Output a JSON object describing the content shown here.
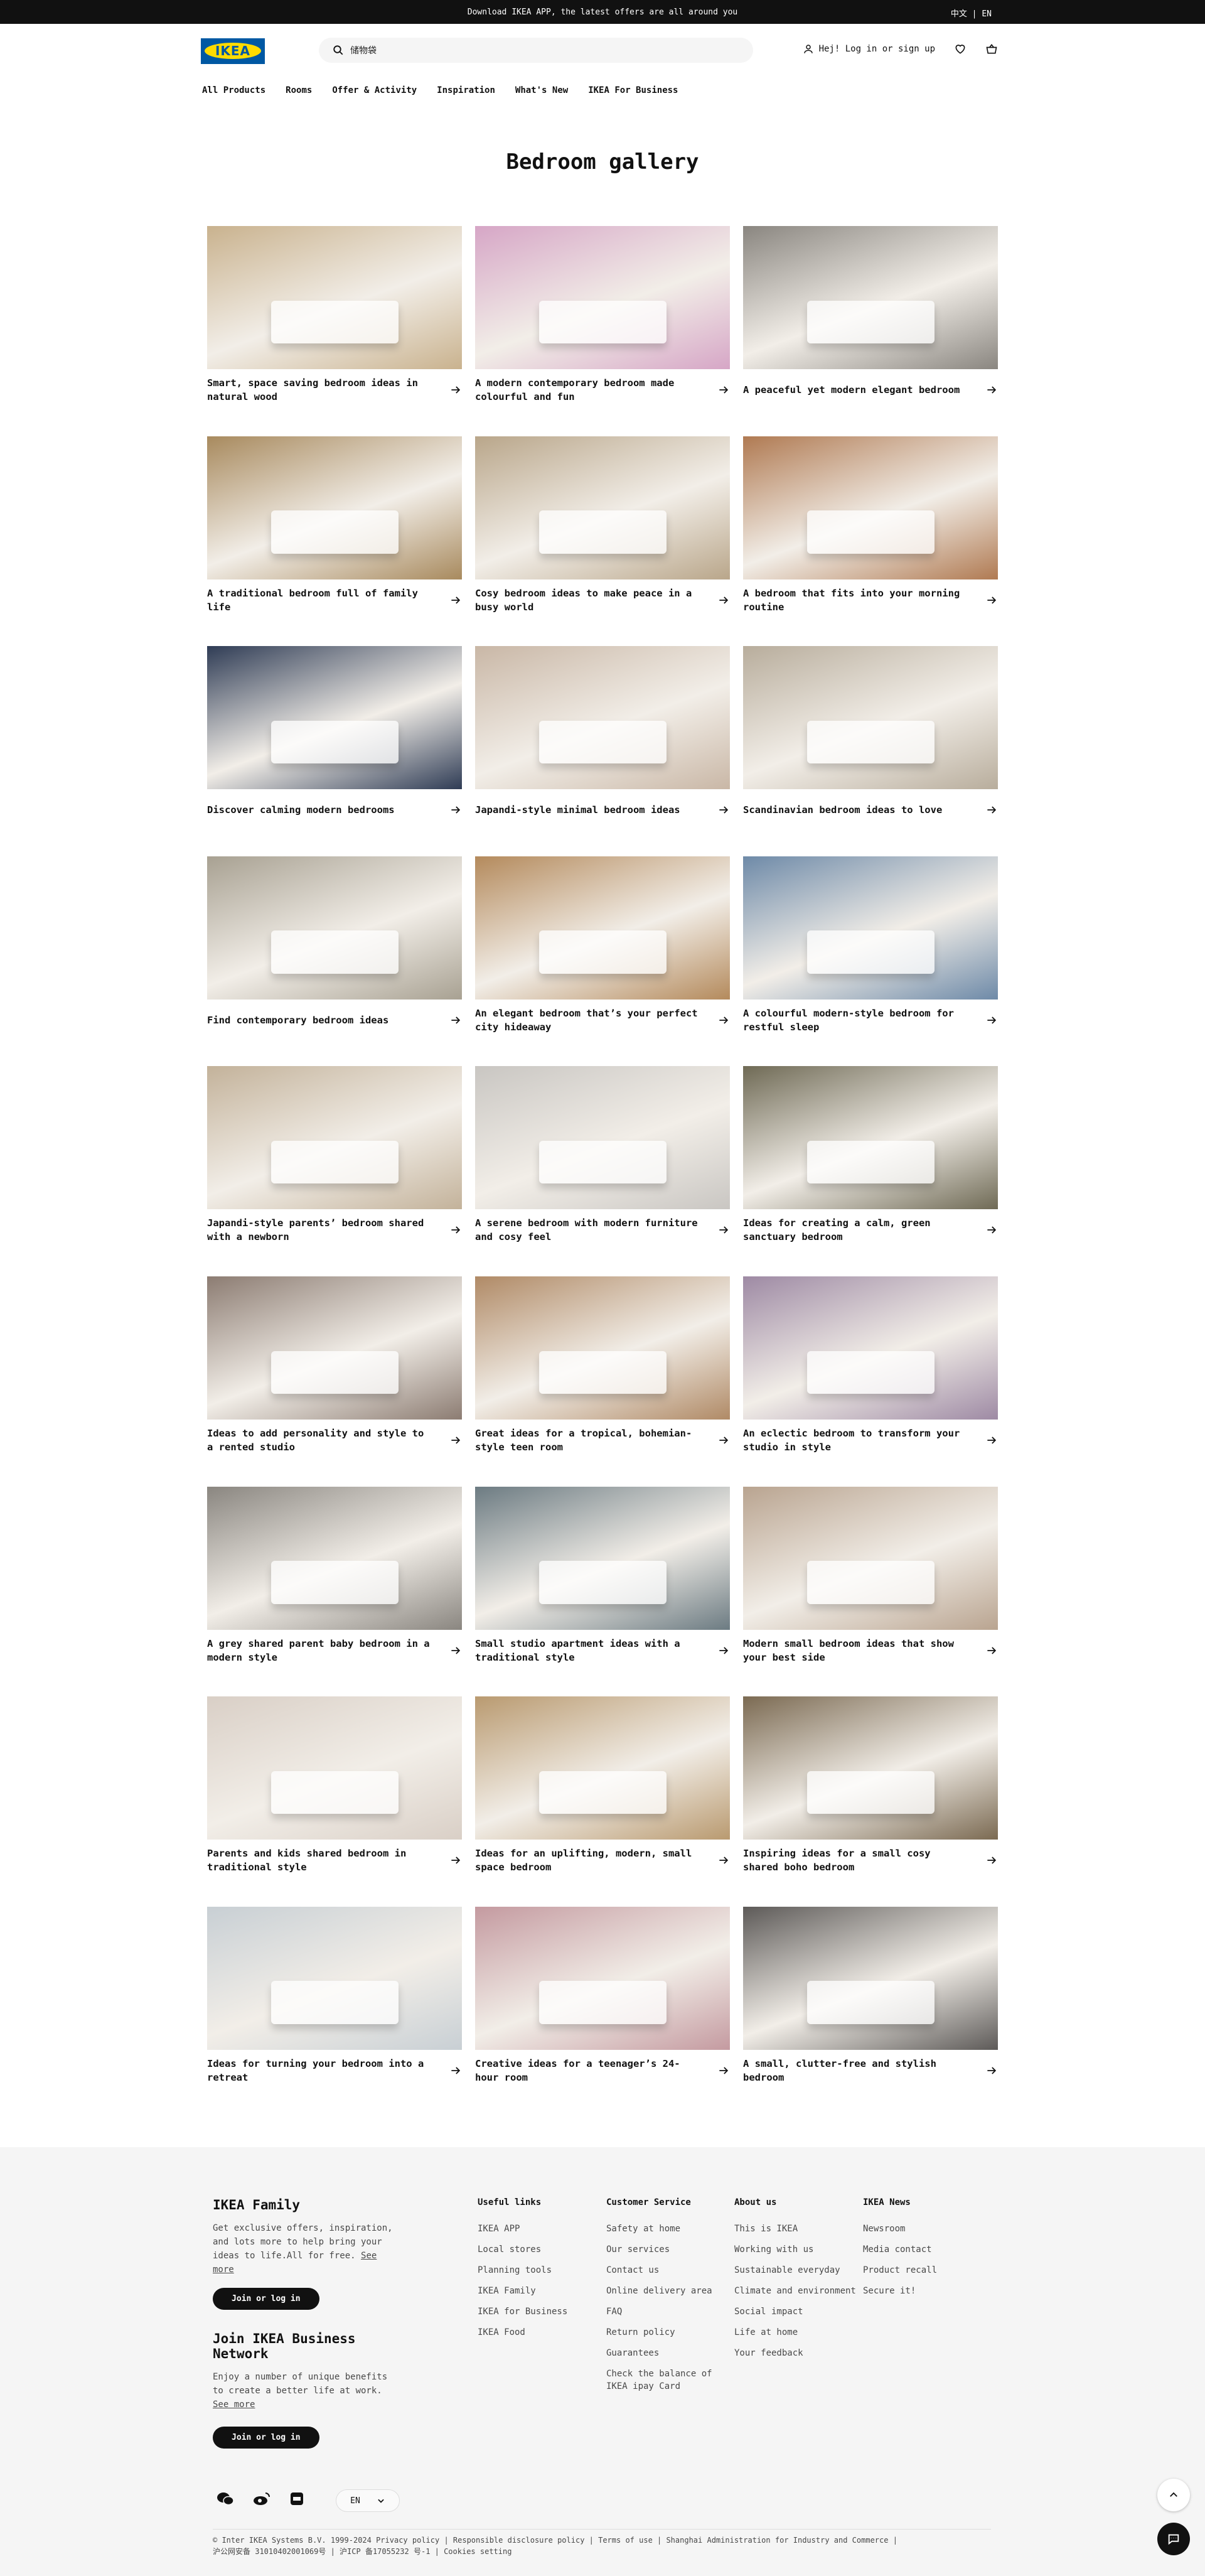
{
  "topbar": {
    "promo": "Download IKEA APP, the latest offers are all around you",
    "lang_switch": "中文 | EN"
  },
  "header": {
    "logo_text": "IKEA",
    "search_value": "储物袋",
    "login_label": "Hej! Log in or sign up",
    "icons": [
      "person-icon",
      "heart-icon",
      "cart-icon",
      "search-icon"
    ]
  },
  "nav": {
    "items": [
      "All Products",
      "Rooms",
      "Offer & Activity",
      "Inspiration",
      "What's New",
      "IKEA For Business"
    ]
  },
  "page": {
    "title": "Bedroom gallery"
  },
  "cards": [
    {
      "label": "Smart, space saving bedroom ideas in natural wood",
      "tone": "#c9b28e"
    },
    {
      "label": "A modern contemporary bedroom made colourful and fun",
      "tone": "#d6a6c6"
    },
    {
      "label": "A peaceful yet modern elegant bedroom",
      "tone": "#8a8680"
    },
    {
      "label": "A traditional bedroom full of family life",
      "tone": "#a88a5e"
    },
    {
      "label": "Cosy bedroom ideas to make peace in a busy world",
      "tone": "#b9a68a"
    },
    {
      "label": "A bedroom that fits into your morning routine",
      "tone": "#b07a52"
    },
    {
      "label": "Discover calming modern bedrooms",
      "tone": "#2f3c55"
    },
    {
      "label": "Japandi-style minimal bedroom ideas",
      "tone": "#c9b7a6"
    },
    {
      "label": "Scandinavian bedroom ideas to love",
      "tone": "#b8ad9c"
    },
    {
      "label": "Find contemporary bedroom ideas",
      "tone": "#a8a192"
    },
    {
      "label": "An elegant bedroom that’s your perfect city hideaway",
      "tone": "#b48a5c"
    },
    {
      "label": "A colourful modern-style bedroom for restful sleep",
      "tone": "#6e8aa8"
    },
    {
      "label": "Japandi-style parents’ bedroom shared with a newborn",
      "tone": "#c3b29a"
    },
    {
      "label": "A serene bedroom with modern furniture and cosy feel",
      "tone": "#c9c6c2"
    },
    {
      "label": "Ideas for creating a calm, green sanctuary bedroom",
      "tone": "#6f6a55"
    },
    {
      "label": "Ideas to add personality and style to a rented studio",
      "tone": "#8c7c72"
    },
    {
      "label": "Great ideas for a tropical, bohemian-style teen room",
      "tone": "#b08a66"
    },
    {
      "label": "An eclectic bedroom to transform your studio in style",
      "tone": "#9e8aa4"
    },
    {
      "label": "A grey shared parent baby bedroom in a modern style",
      "tone": "#8a8680"
    },
    {
      "label": "Small studio apartment ideas with a traditional style",
      "tone": "#6c7b82"
    },
    {
      "label": "Modern small bedroom ideas that show your best side",
      "tone": "#b9a490"
    },
    {
      "label": "Parents and kids shared bedroom in traditional style",
      "tone": "#d9cfc6"
    },
    {
      "label": "Ideas for an uplifting, modern, small space bedroom",
      "tone": "#b99a70"
    },
    {
      "label": "Inspiring ideas for a small cosy shared boho bedroom",
      "tone": "#7b6a52"
    },
    {
      "label": "Ideas for turning your bedroom into a retreat",
      "tone": "#c8cfd4"
    },
    {
      "label": "Creative ideas for a teenager’s 24-hour room",
      "tone": "#c49aa0"
    },
    {
      "label": "A small, clutter-free and stylish bedroom",
      "tone": "#5d5a58"
    }
  ],
  "footer": {
    "family": {
      "title": "IKEA Family",
      "text": "Get exclusive offers, inspiration, and lots more to help bring your ideas to life.All for free.",
      "link": "See more",
      "button": "Join or log in"
    },
    "business": {
      "title": "Join IKEA Business Network",
      "text": "Enjoy a number of unique benefits to create a better life at work.",
      "link": "See more",
      "button": "Join or log in"
    },
    "columns": [
      {
        "title": "Useful links",
        "links": [
          "IKEA APP",
          "Local stores",
          "Planning tools",
          "IKEA Family",
          "IKEA for Business",
          "IKEA Food"
        ]
      },
      {
        "title": "Customer Service",
        "links": [
          "Safety at home",
          "Our services",
          "Contact us",
          "Online delivery area",
          "FAQ",
          "Return policy",
          "Guarantees",
          "Check the balance of IKEA ipay Card"
        ]
      },
      {
        "title": "About us",
        "links": [
          "This is IKEA",
          "Working with us",
          "Sustainable everyday",
          "Climate and environment",
          "Social impact",
          "Life at home",
          "Your feedback"
        ]
      },
      {
        "title": "IKEA News",
        "links": [
          "Newsroom",
          "Media contact",
          "Product recall",
          "Secure it!"
        ]
      }
    ],
    "lang_select": "EN",
    "legal_line1": "© Inter IKEA Systems B.V. 1999-2024   Privacy policy  | Responsible disclosure policy  | Terms of use  | Shanghai Administration for Industry and Commerce  |",
    "legal_line2": "沪公网安备 31010402001069号  | 沪ICP 备17055232 号-1  | Cookies setting"
  }
}
